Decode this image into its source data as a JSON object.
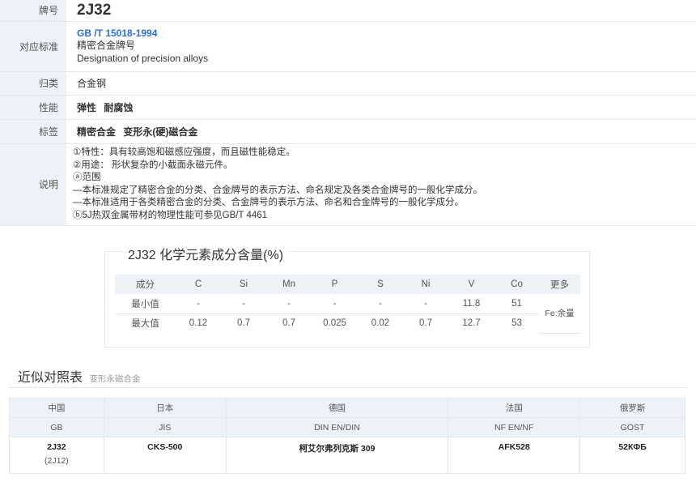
{
  "info": {
    "grade_label": "牌号",
    "grade": "2J32",
    "standard_label": "对应标准",
    "standard_code": "GB /T 15018-1994",
    "standard_name_cn": "精密合金牌号",
    "standard_name_en": "Designation of precision alloys",
    "category_label": "归类",
    "category": "合金钢",
    "property_label": "性能",
    "properties": [
      "弹性",
      "耐腐蚀"
    ],
    "tag_label": "标签",
    "tags": [
      "精密合金",
      "变形永(硬)磁合金"
    ],
    "desc_label": "说明",
    "description": [
      "①特性：具有较高饱和磁感应强度，而且磁性能稳定。",
      "②用途： 形状复杂的小截面永磁元件。",
      "ⓐ范围",
      "—本标准规定了精密合金的分类、合金牌号的表示方法、命名规定及各类合金牌号的一般化学成分。",
      "—本标准适用于各类精密合金的分类、合金牌号的表示方法、命名和合金牌号的一般化学成分。",
      "ⓑ5J热双金属带材的物理性能可参见GB/T 4461"
    ]
  },
  "composition": {
    "title": "2J32 化学元素成分含量(%)",
    "header": [
      "成分",
      "C",
      "Si",
      "Mn",
      "P",
      "S",
      "Ni",
      "V",
      "Co"
    ],
    "more_label": "更多",
    "min_row": [
      "最小值",
      "-",
      "-",
      "-",
      "-",
      "-",
      "-",
      "11.8",
      "51"
    ],
    "max_row": [
      "最大值",
      "0.12",
      "0.7",
      "0.7",
      "0.025",
      "0.02",
      "0.7",
      "12.7",
      "53"
    ],
    "balance": "Fe:余量"
  },
  "equivalents": {
    "title": "近似对照表",
    "subtitle": "变形永磁合金",
    "countries": [
      "中国",
      "日本",
      "德国",
      "法国",
      "俄罗斯"
    ],
    "standards": [
      "GB",
      "JIS",
      "DIN EN/DIN",
      "NF EN/NF",
      "GOST"
    ],
    "grades": [
      "2J32",
      "CKS-500",
      "柯艾尔弗列克斯 309",
      "AFK528",
      "52КФБ"
    ],
    "cn_alt": "(2J12)"
  }
}
